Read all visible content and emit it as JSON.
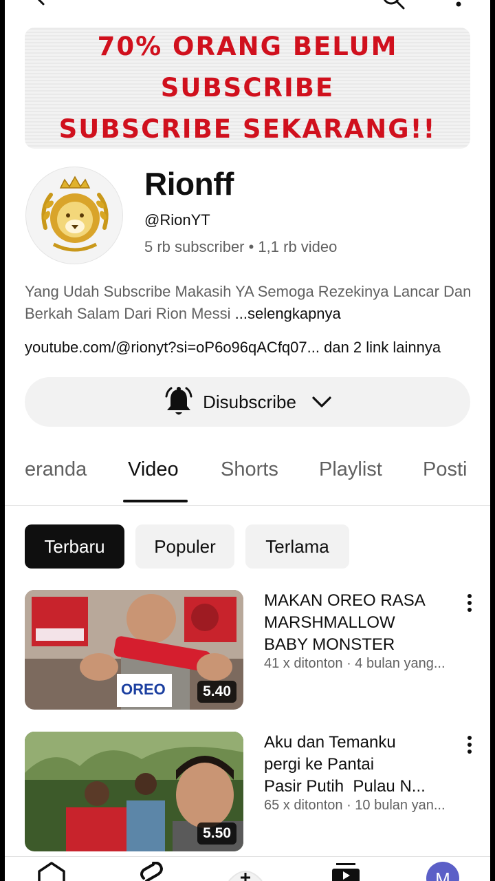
{
  "icons": {
    "back": "arrow-left-icon",
    "search": "search-icon",
    "more": "more-vertical-icon",
    "bell": "bell-ringing-icon",
    "chevron": "chevron-down-icon"
  },
  "colors": {
    "banner_text": "#d0101d",
    "active_chip": "#0f0f0f",
    "avatar_badge": "#5b5fc7"
  },
  "banner": {
    "line1": "70% ORANG BELUM",
    "line2": "SUBSCRIBE",
    "line3": "SUBSCRIBE SEKARANG!!"
  },
  "channel": {
    "name": "Rionff",
    "handle": "@RionYT",
    "stats": "5 rb subscriber • 1,1 rb video",
    "description": "Yang Udah Subscribe Makasih YA Semoga Rezekinya Lancar Dan Berkah Salam Dari Rion Messi ",
    "more_label": "...selengkapnya",
    "link": "youtube.com/@rionyt?si=oP6o96qACfq07...",
    "link_extra": " dan 2 link lainnya"
  },
  "subscribe_button": {
    "label": "Disubscribe"
  },
  "tabs": [
    "eranda",
    "Video",
    "Shorts",
    "Playlist",
    "Posti"
  ],
  "active_tab": "Video",
  "chips": [
    "Terbaru",
    "Populer",
    "Terlama"
  ],
  "videos": [
    {
      "title_lines": [
        "MAKAN OREO RASA",
        "MARSHMALLOW",
        "BABY MONSTER"
      ],
      "meta": "41 x ditonton · 4 bulan yang...",
      "duration": "5.40",
      "thumb_logo": "OREO"
    },
    {
      "title_lines": [
        "Aku dan Temanku",
        "pergi ke Pantai",
        "Pasir Putih  Pulau N..."
      ],
      "meta": "65 x ditonton · 10 bulan yan...",
      "duration": "5.50"
    }
  ],
  "bottom_nav": {
    "home": "home-icon",
    "shorts": "shorts-icon",
    "create": "create-plus-icon",
    "subscriptions": "subscriptions-icon",
    "avatar_letter": "M"
  }
}
